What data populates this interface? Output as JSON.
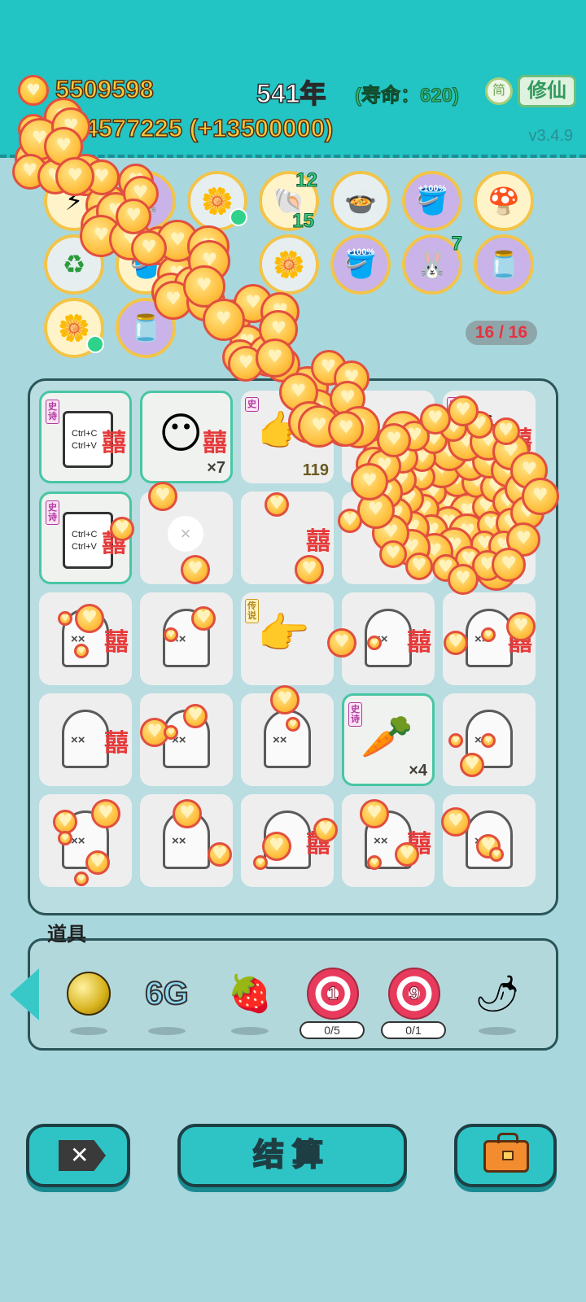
{
  "header": {
    "gold": "5509598",
    "gold_rate": "+94577225 (+13500000)",
    "year": "541年",
    "lifespan": "(寿命：620)",
    "simplified_label": "简",
    "cultivate_label": "修仙",
    "version": "v3.4.9"
  },
  "relics": [
    {
      "icon": "lightning-icon",
      "glyph": "⚡"
    },
    {
      "icon": "bunny-icon",
      "glyph": "🐰"
    },
    {
      "icon": "flower-pot-icon",
      "glyph": "🌼"
    },
    {
      "icon": "shell-icon",
      "glyph": "🐚",
      "num_top": "12",
      "num_bottom": "15"
    },
    {
      "icon": "rice-cooker-icon",
      "glyph": "🍲"
    },
    {
      "icon": "bucket-icon",
      "glyph": "+100%"
    },
    {
      "icon": "mushroom-cloud-icon",
      "glyph": "🍄"
    },
    {
      "icon": "recycle-icon",
      "glyph": "♻"
    },
    {
      "icon": "bucket-icon",
      "glyph": "+100%"
    },
    {
      "icon": "flower-pot-icon",
      "glyph": "🌼"
    },
    {
      "icon": "bucket-icon",
      "glyph": "+100%"
    },
    {
      "icon": "bunny-icon",
      "glyph": "🐰",
      "num_top": "7"
    },
    {
      "icon": "jar-icon",
      "glyph": "🫙"
    },
    {
      "icon": "flower-pot-icon",
      "glyph": "🌼"
    },
    {
      "icon": "jar-icon",
      "glyph": "🫙"
    }
  ],
  "page_counter": "16 / 16",
  "grid": {
    "cells": [
      {
        "kind": "copy",
        "rarity": "史诗",
        "line1": "Ctrl+C",
        "line2": "Ctrl+V",
        "xi": "囍"
      },
      {
        "kind": "face",
        "rarity": "",
        "count": "×7",
        "xi": "囍"
      },
      {
        "kind": "hand",
        "rarity": "史",
        "count": "119"
      },
      {
        "kind": "plain",
        "rarity": ""
      },
      {
        "kind": "scissors",
        "rarity": "史",
        "xi": "囍"
      },
      {
        "kind": "copy",
        "rarity": "史诗",
        "line1": "Ctrl+C",
        "line2": "Ctrl+V",
        "xi": "囍"
      },
      {
        "kind": "empty",
        "rarity": ""
      },
      {
        "kind": "plain",
        "rarity": "",
        "xi": "囍"
      },
      {
        "kind": "plain",
        "rarity": ""
      },
      {
        "kind": "plain",
        "rarity": ""
      },
      {
        "kind": "ghost",
        "xi": "囍"
      },
      {
        "kind": "ghost"
      },
      {
        "kind": "hand",
        "rarity": "传说"
      },
      {
        "kind": "ghost",
        "xi": "囍"
      },
      {
        "kind": "ghost",
        "xi": "囍"
      },
      {
        "kind": "ghost",
        "xi": "囍"
      },
      {
        "kind": "ghost"
      },
      {
        "kind": "ghost"
      },
      {
        "kind": "carrot",
        "rarity": "史诗",
        "count": "×4"
      },
      {
        "kind": "ghost"
      },
      {
        "kind": "ghost"
      },
      {
        "kind": "ghost"
      },
      {
        "kind": "ghost",
        "xi": "囍"
      },
      {
        "kind": "ghost",
        "xi": "囍"
      },
      {
        "kind": "ghost"
      }
    ]
  },
  "tools": {
    "title": "道具",
    "items": [
      {
        "icon": "golden-ball-icon"
      },
      {
        "icon": "6g-icon",
        "label": "6G"
      },
      {
        "icon": "strawberry-icon"
      },
      {
        "icon": "target-icon",
        "label": "1",
        "progress": "0/5"
      },
      {
        "icon": "target-icon",
        "label": "9",
        "progress": "0/1"
      },
      {
        "icon": "chili-icon"
      }
    ]
  },
  "actions": {
    "settle_label": "结算"
  },
  "colors": {
    "topbar": "#22c4c4",
    "background": "#a8d8de",
    "accent": "#2ec4c6",
    "gold_text": "#f7c93a"
  }
}
